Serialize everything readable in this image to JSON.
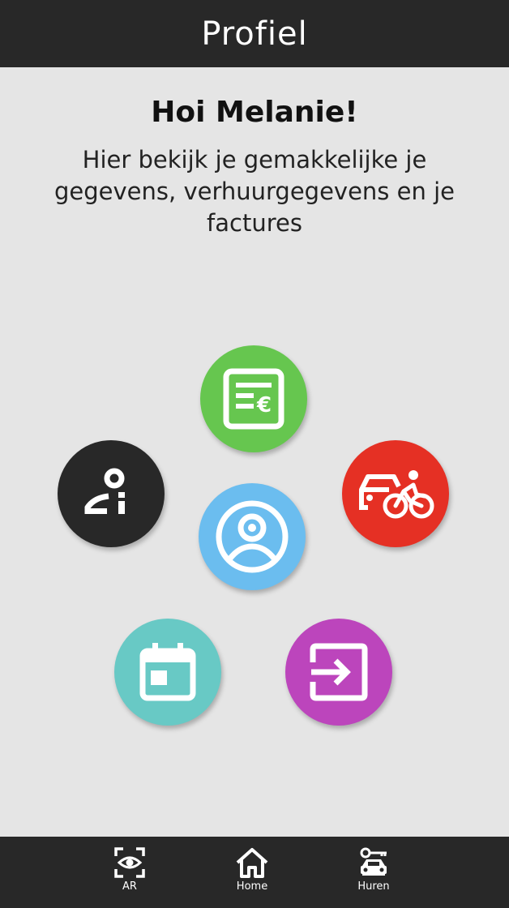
{
  "header": {
    "title": "Profiel"
  },
  "greeting": "Hoi  Melanie!",
  "intro": "Hier bekijk je gemakkelijke je gegevens, verhuurgegevens en je factures",
  "menu": {
    "invoices": {
      "icon": "invoice-euro-icon",
      "color": "#66c64f"
    },
    "user_info": {
      "icon": "user-info-icon",
      "color": "#282828"
    },
    "rentals": {
      "icon": "car-bike-icon",
      "color": "#e53024"
    },
    "profile": {
      "icon": "account-circle-icon",
      "color": "#6bbdef"
    },
    "calendar": {
      "icon": "calendar-icon",
      "color": "#68c9c5"
    },
    "logout": {
      "icon": "logout-icon",
      "color": "#bc45bc"
    }
  },
  "nav": [
    {
      "label": "AR",
      "icon": "ar-eye-icon"
    },
    {
      "label": "Home",
      "icon": "home-icon"
    },
    {
      "label": "Huren",
      "icon": "key-car-icon"
    }
  ]
}
